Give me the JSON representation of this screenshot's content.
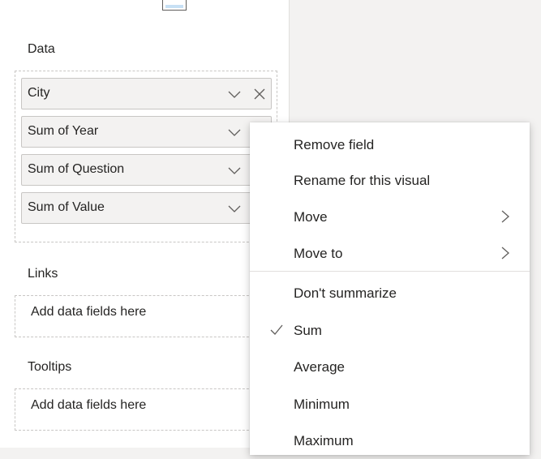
{
  "fields_pane": {
    "sections": {
      "data": {
        "label": "Data"
      },
      "links": {
        "label": "Links",
        "placeholder": "Add data fields here"
      },
      "tooltips": {
        "label": "Tooltips",
        "placeholder": "Add data fields here"
      }
    },
    "data_fields": [
      {
        "label": "City",
        "has_remove": true
      },
      {
        "label": "Sum of Year",
        "has_remove": false
      },
      {
        "label": "Sum of Question",
        "has_remove": false
      },
      {
        "label": "Sum of Value",
        "has_remove": false
      }
    ]
  },
  "context_menu": {
    "items": [
      {
        "label": "Remove field"
      },
      {
        "label": "Rename for this visual"
      },
      {
        "label": "Move",
        "submenu": true
      },
      {
        "label": "Move to",
        "submenu": true
      },
      {
        "label": "Don't summarize"
      },
      {
        "label": "Sum",
        "checked": true
      },
      {
        "label": "Average"
      },
      {
        "label": "Minimum"
      },
      {
        "label": "Maximum"
      }
    ]
  },
  "colors": {
    "pane_bg": "#ffffff",
    "canvas_bg": "#f3f2f1",
    "pill_bg": "#f3f2f1",
    "border": "#c8c6c4",
    "text": "#252423",
    "icon": "#605e5c"
  }
}
